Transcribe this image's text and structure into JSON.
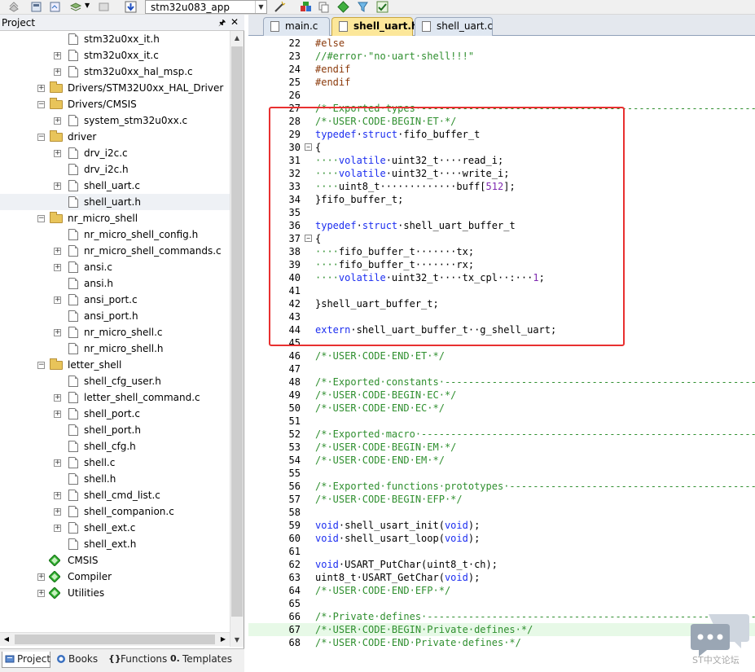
{
  "toolbar": {
    "target_name": "stm32u083_app"
  },
  "project_panel": {
    "title": "Project",
    "tree": [
      {
        "label": "stm32u0xx_it.h",
        "type": "file",
        "depth": 3,
        "expander": false
      },
      {
        "label": "stm32u0xx_it.c",
        "type": "file",
        "depth": 3,
        "expander": true
      },
      {
        "label": "stm32u0xx_hal_msp.c",
        "type": "file",
        "depth": 3,
        "expander": true
      },
      {
        "label": "Drivers/STM32U0xx_HAL_Driver",
        "type": "folder",
        "depth": 2,
        "expander": "plus"
      },
      {
        "label": "Drivers/CMSIS",
        "type": "folder",
        "depth": 2,
        "expander": "minus"
      },
      {
        "label": "system_stm32u0xx.c",
        "type": "file",
        "depth": 3,
        "expander": true
      },
      {
        "label": "driver",
        "type": "folder",
        "depth": 2,
        "expander": "minus"
      },
      {
        "label": "drv_i2c.c",
        "type": "file",
        "depth": 3,
        "expander": true
      },
      {
        "label": "drv_i2c.h",
        "type": "file",
        "depth": 3,
        "expander": false
      },
      {
        "label": "shell_uart.c",
        "type": "file",
        "depth": 3,
        "expander": true
      },
      {
        "label": "shell_uart.h",
        "type": "file",
        "depth": 3,
        "expander": false,
        "selected": true
      },
      {
        "label": "nr_micro_shell",
        "type": "folder",
        "depth": 2,
        "expander": "minus"
      },
      {
        "label": "nr_micro_shell_config.h",
        "type": "file",
        "depth": 3,
        "expander": false
      },
      {
        "label": "nr_micro_shell_commands.c",
        "type": "file",
        "depth": 3,
        "expander": true
      },
      {
        "label": "ansi.c",
        "type": "file",
        "depth": 3,
        "expander": true
      },
      {
        "label": "ansi.h",
        "type": "file",
        "depth": 3,
        "expander": false
      },
      {
        "label": "ansi_port.c",
        "type": "file",
        "depth": 3,
        "expander": true
      },
      {
        "label": "ansi_port.h",
        "type": "file",
        "depth": 3,
        "expander": false
      },
      {
        "label": "nr_micro_shell.c",
        "type": "file",
        "depth": 3,
        "expander": true
      },
      {
        "label": "nr_micro_shell.h",
        "type": "file",
        "depth": 3,
        "expander": false
      },
      {
        "label": "letter_shell",
        "type": "folder",
        "depth": 2,
        "expander": "minus"
      },
      {
        "label": "shell_cfg_user.h",
        "type": "file",
        "depth": 3,
        "expander": false
      },
      {
        "label": "letter_shell_command.c",
        "type": "file",
        "depth": 3,
        "expander": true
      },
      {
        "label": "shell_port.c",
        "type": "file",
        "depth": 3,
        "expander": true
      },
      {
        "label": "shell_port.h",
        "type": "file",
        "depth": 3,
        "expander": false
      },
      {
        "label": "shell_cfg.h",
        "type": "file",
        "depth": 3,
        "expander": false
      },
      {
        "label": "shell.c",
        "type": "file",
        "depth": 3,
        "expander": true
      },
      {
        "label": "shell.h",
        "type": "file",
        "depth": 3,
        "expander": false
      },
      {
        "label": "shell_cmd_list.c",
        "type": "file",
        "depth": 3,
        "expander": true
      },
      {
        "label": "shell_companion.c",
        "type": "file",
        "depth": 3,
        "expander": true
      },
      {
        "label": "shell_ext.c",
        "type": "file",
        "depth": 3,
        "expander": true
      },
      {
        "label": "shell_ext.h",
        "type": "file",
        "depth": 3,
        "expander": false
      },
      {
        "label": "CMSIS",
        "type": "pack",
        "depth": 2,
        "expander": false
      },
      {
        "label": "Compiler",
        "type": "pack",
        "depth": 2,
        "expander": "plus"
      },
      {
        "label": "Utilities",
        "type": "pack",
        "depth": 2,
        "expander": "plus"
      }
    ],
    "bottom_tabs": [
      {
        "label": "Project",
        "active": true
      },
      {
        "label": "Books",
        "active": false
      },
      {
        "label": "Functions",
        "active": false
      },
      {
        "label": "Templates",
        "active": false
      }
    ]
  },
  "editor": {
    "tabs": [
      {
        "label": "main.c",
        "active": false
      },
      {
        "label": "shell_uart.h",
        "active": true
      },
      {
        "label": "shell_uart.c",
        "active": false
      }
    ],
    "lines": [
      {
        "n": "22",
        "segs": [
          [
            "pre",
            "#else"
          ]
        ]
      },
      {
        "n": "23",
        "segs": [
          [
            "com",
            "//#error·\"no·uart·shell!!!\""
          ]
        ]
      },
      {
        "n": "24",
        "segs": [
          [
            "pre",
            "#endif"
          ]
        ]
      },
      {
        "n": "25",
        "segs": [
          [
            "pre",
            "#endif"
          ]
        ]
      },
      {
        "n": "26",
        "segs": []
      },
      {
        "n": "27",
        "segs": [
          [
            "com",
            "/*·Exported·types·-------------------------------------------------------------"
          ]
        ]
      },
      {
        "n": "28",
        "segs": [
          [
            "com",
            "/*·USER·CODE·BEGIN·ET·*/"
          ]
        ]
      },
      {
        "n": "29",
        "segs": [
          [
            "kw",
            "typedef"
          ],
          [
            "id",
            "·"
          ],
          [
            "kw",
            "struct"
          ],
          [
            "id",
            "·fifo_buffer_t"
          ]
        ]
      },
      {
        "n": "30",
        "segs": [
          [
            "id",
            "{"
          ]
        ],
        "fold": "open"
      },
      {
        "n": "31",
        "segs": [
          [
            "com",
            "····"
          ],
          [
            "kw",
            "volatile"
          ],
          [
            "id",
            "·uint32_t····read_i;"
          ]
        ]
      },
      {
        "n": "32",
        "segs": [
          [
            "com",
            "····"
          ],
          [
            "kw",
            "volatile"
          ],
          [
            "id",
            "·uint32_t····write_i;"
          ]
        ]
      },
      {
        "n": "33",
        "segs": [
          [
            "com",
            "····"
          ],
          [
            "id",
            "uint8_t·············buff["
          ],
          [
            "num",
            "512"
          ],
          [
            "id",
            "];"
          ]
        ]
      },
      {
        "n": "34",
        "segs": [
          [
            "id",
            "}fifo_buffer_t;"
          ]
        ]
      },
      {
        "n": "35",
        "segs": []
      },
      {
        "n": "36",
        "segs": [
          [
            "kw",
            "typedef"
          ],
          [
            "id",
            "·"
          ],
          [
            "kw",
            "struct"
          ],
          [
            "id",
            "·shell_uart_buffer_t"
          ]
        ]
      },
      {
        "n": "37",
        "segs": [
          [
            "id",
            "{"
          ]
        ],
        "fold": "open"
      },
      {
        "n": "38",
        "segs": [
          [
            "com",
            "····"
          ],
          [
            "id",
            "fifo_buffer_t·······tx;"
          ]
        ]
      },
      {
        "n": "39",
        "segs": [
          [
            "com",
            "····"
          ],
          [
            "id",
            "fifo_buffer_t·······rx;"
          ]
        ]
      },
      {
        "n": "40",
        "segs": [
          [
            "com",
            "····"
          ],
          [
            "kw",
            "volatile"
          ],
          [
            "id",
            "·uint32_t····tx_cpl··:···"
          ],
          [
            "num",
            "1"
          ],
          [
            "id",
            ";"
          ]
        ]
      },
      {
        "n": "41",
        "segs": []
      },
      {
        "n": "42",
        "segs": [
          [
            "id",
            "}shell_uart_buffer_t;"
          ]
        ]
      },
      {
        "n": "43",
        "segs": []
      },
      {
        "n": "44",
        "segs": [
          [
            "kw",
            "extern"
          ],
          [
            "id",
            "·shell_uart_buffer_t··g_shell_uart;"
          ]
        ]
      },
      {
        "n": "45",
        "segs": []
      },
      {
        "n": "46",
        "segs": [
          [
            "com",
            "/*·USER·CODE·END·ET·*/"
          ]
        ]
      },
      {
        "n": "47",
        "segs": []
      },
      {
        "n": "48",
        "segs": [
          [
            "com",
            "/*·Exported·constants·---------------------------------------------------------"
          ]
        ]
      },
      {
        "n": "49",
        "segs": [
          [
            "com",
            "/*·USER·CODE·BEGIN·EC·*/"
          ]
        ]
      },
      {
        "n": "50",
        "segs": [
          [
            "com",
            "/*·USER·CODE·END·EC·*/"
          ]
        ]
      },
      {
        "n": "51",
        "segs": []
      },
      {
        "n": "52",
        "segs": [
          [
            "com",
            "/*·Exported·macro·-------------------------------------------------------------"
          ]
        ]
      },
      {
        "n": "53",
        "segs": [
          [
            "com",
            "/*·USER·CODE·BEGIN·EM·*/"
          ]
        ]
      },
      {
        "n": "54",
        "segs": [
          [
            "com",
            "/*·USER·CODE·END·EM·*/"
          ]
        ]
      },
      {
        "n": "55",
        "segs": []
      },
      {
        "n": "56",
        "segs": [
          [
            "com",
            "/*·Exported·functions·prototypes·----------------------------------------------"
          ]
        ]
      },
      {
        "n": "57",
        "segs": [
          [
            "com",
            "/*·USER·CODE·BEGIN·EFP·*/"
          ]
        ]
      },
      {
        "n": "58",
        "segs": []
      },
      {
        "n": "59",
        "segs": [
          [
            "kw",
            "void"
          ],
          [
            "id",
            "·shell_usart_init("
          ],
          [
            "kw",
            "void"
          ],
          [
            "id",
            ");"
          ]
        ]
      },
      {
        "n": "60",
        "segs": [
          [
            "kw",
            "void"
          ],
          [
            "id",
            "·shell_usart_loop("
          ],
          [
            "kw",
            "void"
          ],
          [
            "id",
            ");"
          ]
        ]
      },
      {
        "n": "61",
        "segs": []
      },
      {
        "n": "62",
        "segs": [
          [
            "kw",
            "void"
          ],
          [
            "id",
            "·USART_PutChar(uint8_t·ch);"
          ]
        ]
      },
      {
        "n": "63",
        "segs": [
          [
            "id",
            "uint8_t·USART_GetChar("
          ],
          [
            "kw",
            "void"
          ],
          [
            "id",
            ");"
          ]
        ]
      },
      {
        "n": "64",
        "segs": [
          [
            "com",
            "/*·USER·CODE·END·EFP·*/"
          ]
        ]
      },
      {
        "n": "65",
        "segs": []
      },
      {
        "n": "66",
        "segs": [
          [
            "com",
            "/*·Private·defines·-------------------------------------------------------------"
          ]
        ]
      },
      {
        "n": "67",
        "segs": [
          [
            "com",
            "/*·USER·CODE·BEGIN·Private·defines·*/"
          ]
        ],
        "highlight": true
      },
      {
        "n": "68",
        "segs": [
          [
            "com",
            "/*·USER·CODE·END·Private·defines·*/"
          ]
        ]
      }
    ]
  },
  "watermark": {
    "text": "ST中文论坛"
  },
  "colors": {
    "comment": "#2f8f2f",
    "keyword": "#1c2ef0",
    "preprocessor": "#8b3a0b",
    "number": "#7f2ab0",
    "annotation_box": "#e83030",
    "active_tab": "#fce79a"
  }
}
